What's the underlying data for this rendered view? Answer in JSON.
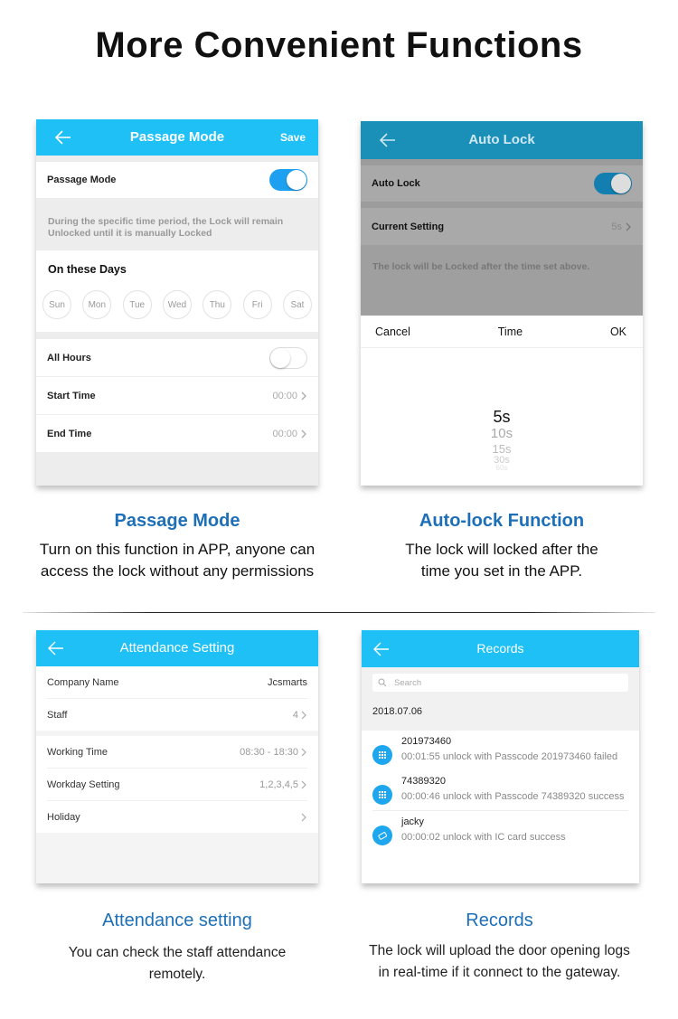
{
  "page_title": "More Convenient Functions",
  "colors": {
    "app_bar": "#1ec0f5",
    "app_bar_dimmed": "#1a8fb8",
    "toggle_on": "#1ea0f0",
    "caption_heading": "#1d6fb8"
  },
  "passage_mode_screen": {
    "nav_title": "Passage Mode",
    "save_label": "Save",
    "toggle_label": "Passage Mode",
    "toggle_on": true,
    "description": "During the specific time period, the Lock will remain Unlocked until it is manually Locked",
    "days_heading": "On these Days",
    "days": [
      "Sun",
      "Mon",
      "Tue",
      "Wed",
      "Thu",
      "Fri",
      "Sat"
    ],
    "all_hours_label": "All Hours",
    "all_hours_on": false,
    "start_time_label": "Start Time",
    "start_time_value": "00:00",
    "end_time_label": "End Time",
    "end_time_value": "00:00"
  },
  "auto_lock_screen": {
    "nav_title": "Auto Lock",
    "toggle_label": "Auto Lock",
    "toggle_on": true,
    "current_setting_label": "Current Setting",
    "current_setting_value": "5s",
    "description": "The lock will be Locked after the time set above.",
    "picker": {
      "cancel_label": "Cancel",
      "title": "Time",
      "ok_label": "OK",
      "options": [
        "5s",
        "10s",
        "15s",
        "30s",
        "60s"
      ],
      "selected": "5s"
    }
  },
  "attendance_screen": {
    "nav_title": "Attendance Setting",
    "rows": [
      {
        "label": "Company Name",
        "value": "Jcsmarts",
        "chevron": false
      },
      {
        "label": "Staff",
        "value": "4",
        "chevron": true
      },
      {
        "label": "Working Time",
        "value": "08:30 - 18:30",
        "chevron": true
      },
      {
        "label": "Workday Setting",
        "value": "1,2,3,4,5",
        "chevron": true
      },
      {
        "label": "Holiday",
        "value": "",
        "chevron": true
      }
    ]
  },
  "records_screen": {
    "nav_title": "Records",
    "search_placeholder": "Search",
    "date": "2018.07.06",
    "records": [
      {
        "icon": "keypad-icon",
        "name": "201973460",
        "detail": "00:01:55 unlock with Passcode 201973460 failed"
      },
      {
        "icon": "keypad-icon",
        "name": "74389320",
        "detail": "00:00:46 unlock with Passcode 74389320 success"
      },
      {
        "icon": "card-icon",
        "name": "jacky",
        "detail": "00:00:02 unlock with IC card success"
      }
    ]
  },
  "captions": {
    "passage": {
      "heading": "Passage Mode",
      "line1": "Turn on this function in APP, anyone can",
      "line2": "access the lock without any permissions"
    },
    "autolock": {
      "heading": "Auto-lock Function",
      "line1": "The lock will locked after the",
      "line2": "time you set in the APP."
    },
    "attendance": {
      "heading": "Attendance setting",
      "line1": "You can check the staff attendance",
      "line2": "remotely."
    },
    "records": {
      "heading": "Records",
      "line1": "The lock will upload the door opening logs",
      "line2": "in real-time if it connect to the gateway."
    }
  }
}
